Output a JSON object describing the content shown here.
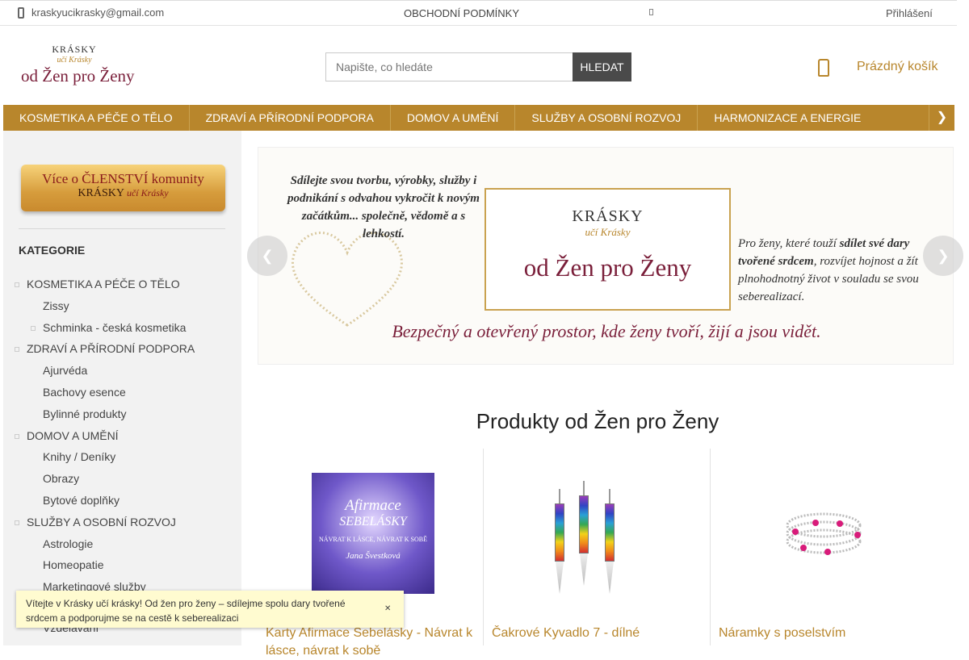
{
  "topbar": {
    "email": "kraskyucikrasky@gmail.com",
    "terms": "OBCHODNÍ PODMÍNKY",
    "login": "Přihlášení"
  },
  "header": {
    "logo": {
      "line1": "KRÁSKY",
      "line2": "učí Krásky",
      "line3": "od Žen pro Ženy"
    },
    "search": {
      "placeholder": "Napište, co hledáte",
      "button": "HLEDAT"
    },
    "cart": "Prázdný košík"
  },
  "nav": {
    "items": [
      "KOSMETIKA A PÉČE O TĚLO",
      "ZDRAVÍ A PŘÍRODNÍ PODPORA",
      "DOMOV A UMĚNÍ",
      "SLUŽBY A OSOBNÍ ROZVOJ",
      "HARMONIZACE A ENERGIE"
    ]
  },
  "sidebar": {
    "member_line1": "Více o ČLENSTVÍ komunity",
    "member_line2": "KRÁSKY",
    "member_line3": "učí Krásky",
    "categories_title": "KATEGORIE",
    "categories": [
      "KOSMETIKA A PÉČE O TĚLO",
      "Zissy",
      "Schminka - česká kosmetika",
      "ZDRAVÍ A PŘÍRODNÍ PODPORA",
      "Ajurvéda",
      "Bachovy esence",
      "Bylinné produkty",
      "DOMOV A UMĚNÍ",
      "Knihy / Deníky",
      "Obrazy",
      "Bytové doplňky",
      "SLUŽBY A OSOBNÍ ROZVOJ",
      "Astrologie",
      "Homeopatie",
      "Marketingové služby"
    ],
    "partial_item": "Vzdělávání"
  },
  "banner": {
    "left_text": "Sdílejte svou tvorbu, výrobky, služby i podnikání s odvahou vykročit k novým začátkům... společně, vědomě a s lehkostí.",
    "center1": "KRÁSKY",
    "center2": "učí Krásky",
    "center3": "od Žen pro Ženy",
    "right_text_a": "Pro ženy, které touží ",
    "right_text_b": "sdílet své dary tvořené srdcem",
    "right_text_c": ", rozvíjet hojnost a žít plnohodnotný život v souladu se svou seberealizací.",
    "bottom_text": "Bezpečný a otevřený prostor, kde ženy tvoří, žijí a jsou vidět."
  },
  "products_title": "Produkty od Žen pro Ženy",
  "products": [
    {
      "name": "Karty Afirmace Sebelásky - Návrat k lásce, návrat k sobě",
      "cover_title1": "Afirmace",
      "cover_title2": "SEBELÁSKY",
      "cover_sub": "NÁVRAT K LÁSCE, NÁVRAT K SOBĚ",
      "cover_author": "Jana Švestková"
    },
    {
      "name": "Čakrové Kyvadlo 7 - dílné"
    },
    {
      "name": "Náramky s poselstvím"
    }
  ],
  "toast": {
    "message": "Vítejte v Krásky učí krásky! Od žen pro ženy – sdílejme spolu dary tvořené srdcem a podporujme se na cestě k seberealizaci"
  },
  "colors": {
    "accent": "#b8862c",
    "brand_dark": "#7a1f3a"
  }
}
